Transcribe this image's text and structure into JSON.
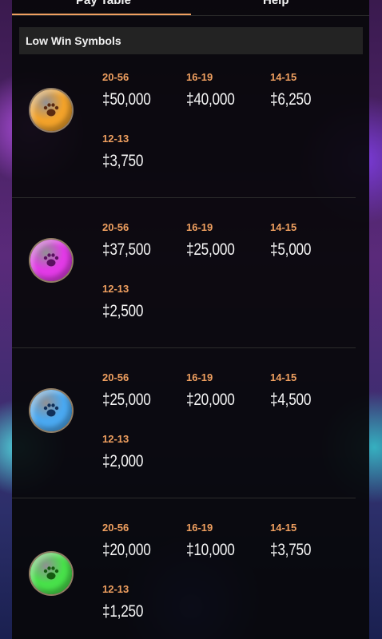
{
  "tabs": {
    "paytable": "Pay Table",
    "help": "Help"
  },
  "section": {
    "title": "Low Win Symbols"
  },
  "symbols": [
    {
      "name": "orange paw",
      "color": "#f2a22a",
      "pays": [
        {
          "range": "20-56",
          "amount": "‡50,000"
        },
        {
          "range": "16-19",
          "amount": "‡40,000"
        },
        {
          "range": "14-15",
          "amount": "‡6,250"
        },
        {
          "range": "12-13",
          "amount": "‡3,750"
        }
      ]
    },
    {
      "name": "pink paw",
      "color": "#e23ae6",
      "pays": [
        {
          "range": "20-56",
          "amount": "‡37,500"
        },
        {
          "range": "16-19",
          "amount": "‡25,000"
        },
        {
          "range": "14-15",
          "amount": "‡5,000"
        },
        {
          "range": "12-13",
          "amount": "‡2,500"
        }
      ]
    },
    {
      "name": "blue paw",
      "color": "#4aa8f0",
      "pays": [
        {
          "range": "20-56",
          "amount": "‡25,000"
        },
        {
          "range": "16-19",
          "amount": "‡20,000"
        },
        {
          "range": "14-15",
          "amount": "‡4,500"
        },
        {
          "range": "12-13",
          "amount": "‡2,000"
        }
      ]
    },
    {
      "name": "green paw",
      "color": "#48e04a",
      "pays": [
        {
          "range": "20-56",
          "amount": "‡20,000"
        },
        {
          "range": "16-19",
          "amount": "‡10,000"
        },
        {
          "range": "14-15",
          "amount": "‡3,750"
        },
        {
          "range": "12-13",
          "amount": "‡1,250"
        }
      ]
    }
  ]
}
